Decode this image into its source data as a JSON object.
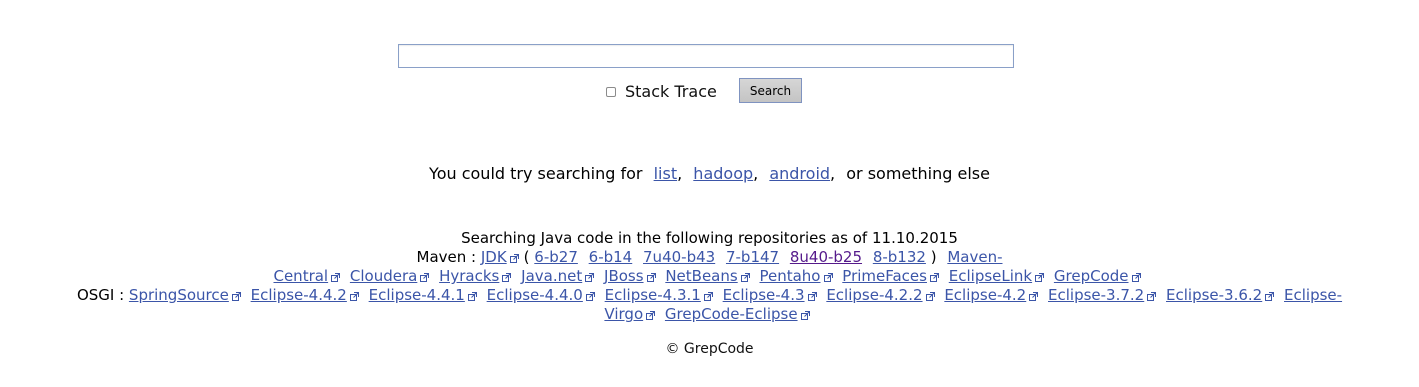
{
  "search": {
    "value": "",
    "placeholder": "",
    "stack_trace_label": "Stack Trace",
    "stack_trace_checked": false,
    "button_label": "Search"
  },
  "suggest": {
    "prefix": "You could try searching for",
    "links": [
      "list",
      "hadoop",
      "android"
    ],
    "suffix": "or something else"
  },
  "repos": {
    "heading": "Searching Java code in the following repositories as of 11.10.2015",
    "maven_label": "Maven :",
    "jdk": "JDK",
    "jdk_versions": [
      "6-b27",
      "6-b14",
      "7u40-b43",
      "7-b147",
      "8u40-b25",
      "8-b132"
    ],
    "maven_line1_last": "Maven-",
    "maven_line2_first": "Central",
    "maven_repos": [
      "Cloudera",
      "Hyracks",
      "Java.net",
      "JBoss",
      "NetBeans",
      "Pentaho",
      "PrimeFaces",
      "EclipseLink",
      "GrepCode"
    ],
    "osgi_label": "OSGI :",
    "osgi_repos": [
      "SpringSource",
      "Eclipse-4.4.2",
      "Eclipse-4.4.1",
      "Eclipse-4.4.0",
      "Eclipse-4.3.1",
      "Eclipse-4.3",
      "Eclipse-4.2.2",
      "Eclipse-4.2",
      "Eclipse-3.7.2",
      "Eclipse-3.6.2"
    ],
    "osgi_line1_last": "Eclipse-",
    "osgi_line2_first": "Virgo",
    "osgi_line2_rest": [
      "GrepCode-Eclipse"
    ]
  },
  "footer": {
    "text": "© GrepCode"
  },
  "colors": {
    "link": "#3b55a8",
    "visited_link": "#551a8b",
    "input_border": "#8aa0c8",
    "button_bg": "#cccccc"
  }
}
